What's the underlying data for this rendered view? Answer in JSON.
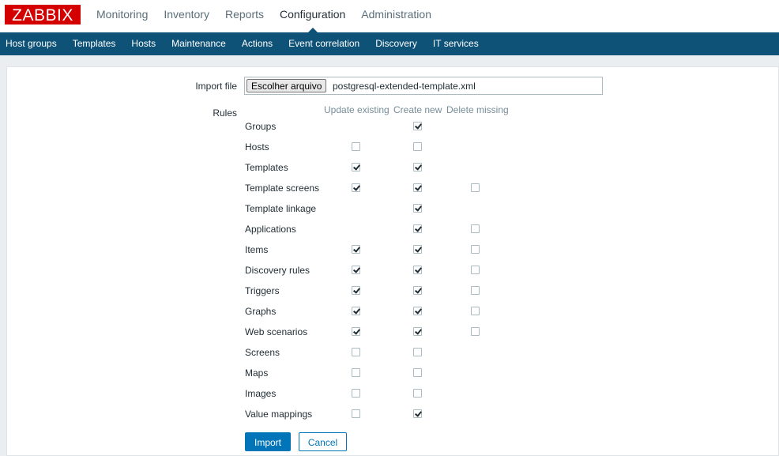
{
  "logo": "ZABBIX",
  "main_menu": [
    {
      "label": "Monitoring",
      "active": false
    },
    {
      "label": "Inventory",
      "active": false
    },
    {
      "label": "Reports",
      "active": false
    },
    {
      "label": "Configuration",
      "active": true
    },
    {
      "label": "Administration",
      "active": false
    }
  ],
  "sub_menu": [
    "Host groups",
    "Templates",
    "Hosts",
    "Maintenance",
    "Actions",
    "Event correlation",
    "Discovery",
    "IT services"
  ],
  "form": {
    "import_file_label": "Import file",
    "choose_file_button": "Escolher arquivo",
    "file_name": "postgresql-extended-template.xml",
    "rules_label": "Rules",
    "columns": [
      "Update existing",
      "Create new",
      "Delete missing"
    ],
    "rules": [
      {
        "name": "Groups",
        "update": null,
        "create": true,
        "delete": null
      },
      {
        "name": "Hosts",
        "update": false,
        "create": false,
        "delete": null
      },
      {
        "name": "Templates",
        "update": true,
        "create": true,
        "delete": null
      },
      {
        "name": "Template screens",
        "update": true,
        "create": true,
        "delete": false
      },
      {
        "name": "Template linkage",
        "update": null,
        "create": true,
        "delete": null
      },
      {
        "name": "Applications",
        "update": null,
        "create": true,
        "delete": false
      },
      {
        "name": "Items",
        "update": true,
        "create": true,
        "delete": false
      },
      {
        "name": "Discovery rules",
        "update": true,
        "create": true,
        "delete": false
      },
      {
        "name": "Triggers",
        "update": true,
        "create": true,
        "delete": false
      },
      {
        "name": "Graphs",
        "update": true,
        "create": true,
        "delete": false
      },
      {
        "name": "Web scenarios",
        "update": true,
        "create": true,
        "delete": false
      },
      {
        "name": "Screens",
        "update": false,
        "create": false,
        "delete": null
      },
      {
        "name": "Maps",
        "update": false,
        "create": false,
        "delete": null
      },
      {
        "name": "Images",
        "update": false,
        "create": false,
        "delete": null
      },
      {
        "name": "Value mappings",
        "update": false,
        "create": true,
        "delete": null
      }
    ],
    "import_button": "Import",
    "cancel_button": "Cancel"
  },
  "colors": {
    "brand_red": "#d40000",
    "nav_blue": "#0f5278",
    "button_blue": "#0275b8"
  }
}
